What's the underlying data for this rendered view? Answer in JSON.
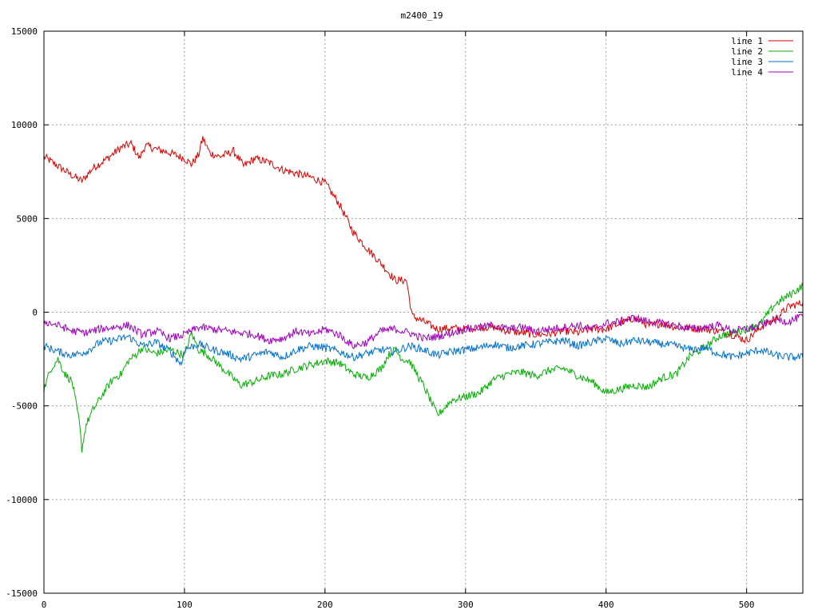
{
  "chart_data": {
    "type": "line",
    "title": "m2400_19",
    "xlabel": "",
    "ylabel": "",
    "xlim": [
      0,
      540
    ],
    "ylim": [
      -15000,
      15000
    ],
    "xticks": [
      0,
      100,
      200,
      300,
      400,
      500
    ],
    "yticks": [
      -15000,
      -10000,
      -5000,
      0,
      5000,
      10000,
      15000
    ],
    "grid": true,
    "legend_position": "top-right",
    "series": [
      {
        "name": "line 1",
        "color": "#dd0000",
        "x": [
          0,
          10,
          20,
          27,
          35,
          45,
          55,
          62,
          68,
          72,
          80,
          90,
          100,
          105,
          110,
          113,
          118,
          125,
          135,
          142,
          150,
          160,
          170,
          180,
          190,
          200,
          210,
          220,
          230,
          240,
          250,
          258,
          262,
          270,
          280,
          290,
          300,
          310,
          320,
          330,
          340,
          350,
          360,
          370,
          380,
          390,
          400,
          410,
          420,
          430,
          440,
          450,
          460,
          470,
          480,
          490,
          500,
          510,
          520,
          530,
          540
        ],
        "y": [
          8300,
          7800,
          7300,
          7000,
          7700,
          8200,
          8800,
          9000,
          8200,
          8900,
          8700,
          8500,
          8200,
          7900,
          8400,
          9300,
          8500,
          8300,
          8600,
          7800,
          8200,
          8000,
          7600,
          7400,
          7200,
          6900,
          5800,
          4300,
          3400,
          2600,
          1700,
          1700,
          -200,
          -500,
          -900,
          -850,
          -900,
          -800,
          -800,
          -1000,
          -1100,
          -1200,
          -1150,
          -1000,
          -1100,
          -900,
          -900,
          -600,
          -300,
          -700,
          -600,
          -800,
          -850,
          -900,
          -1000,
          -1200,
          -1500,
          -800,
          -400,
          300,
          500
        ]
      },
      {
        "name": "line 2",
        "color": "#00b000",
        "x": [
          0,
          5,
          10,
          15,
          20,
          25,
          27,
          30,
          35,
          40,
          45,
          50,
          55,
          60,
          65,
          70,
          75,
          80,
          90,
          100,
          105,
          110,
          115,
          120,
          130,
          140,
          150,
          160,
          170,
          180,
          190,
          200,
          210,
          220,
          230,
          240,
          245,
          250,
          255,
          260,
          270,
          280,
          290,
          300,
          310,
          320,
          330,
          340,
          350,
          360,
          370,
          380,
          390,
          400,
          410,
          420,
          430,
          440,
          450,
          460,
          470,
          480,
          490,
          500,
          510,
          520,
          530,
          540
        ],
        "y": [
          -4100,
          -3000,
          -2500,
          -3300,
          -3700,
          -5800,
          -7300,
          -6000,
          -5200,
          -4600,
          -4000,
          -3500,
          -3300,
          -2600,
          -2300,
          -1900,
          -2100,
          -2200,
          -2000,
          -2300,
          -1100,
          -2000,
          -2200,
          -2500,
          -3200,
          -3900,
          -3700,
          -3400,
          -3300,
          -3000,
          -2800,
          -2600,
          -2700,
          -3300,
          -3500,
          -3000,
          -2300,
          -2000,
          -2500,
          -2600,
          -3900,
          -5500,
          -4700,
          -4500,
          -4300,
          -3600,
          -3300,
          -3200,
          -3400,
          -3100,
          -3000,
          -3400,
          -3700,
          -4300,
          -4100,
          -3900,
          -4000,
          -3500,
          -3300,
          -2300,
          -1900,
          -1300,
          -1100,
          -900,
          -600,
          400,
          900,
          1400
        ]
      },
      {
        "name": "line 3",
        "color": "#0070d0",
        "x": [
          0,
          10,
          20,
          30,
          40,
          50,
          60,
          70,
          80,
          90,
          98,
          100,
          110,
          120,
          130,
          140,
          150,
          160,
          170,
          180,
          190,
          200,
          210,
          220,
          230,
          240,
          250,
          260,
          270,
          280,
          290,
          300,
          310,
          320,
          330,
          340,
          350,
          360,
          370,
          380,
          390,
          400,
          410,
          420,
          430,
          440,
          450,
          460,
          470,
          480,
          490,
          500,
          510,
          520,
          530,
          540
        ],
        "y": [
          -1800,
          -2100,
          -2300,
          -2100,
          -1600,
          -1500,
          -1300,
          -1800,
          -1600,
          -2100,
          -2800,
          -2000,
          -1700,
          -2000,
          -2200,
          -2500,
          -2300,
          -2100,
          -2400,
          -2000,
          -1800,
          -1900,
          -2100,
          -2400,
          -2200,
          -2000,
          -2100,
          -1800,
          -2000,
          -2300,
          -2100,
          -2000,
          -1900,
          -1700,
          -1900,
          -1800,
          -1700,
          -1600,
          -1500,
          -1800,
          -1600,
          -1400,
          -1700,
          -1500,
          -1600,
          -1700,
          -1800,
          -2000,
          -1900,
          -2200,
          -2400,
          -2200,
          -2000,
          -2300,
          -2400,
          -2400
        ]
      },
      {
        "name": "line 4",
        "color": "#a000c0",
        "x": [
          0,
          10,
          20,
          30,
          40,
          50,
          60,
          70,
          80,
          90,
          100,
          110,
          120,
          130,
          140,
          150,
          160,
          170,
          180,
          190,
          200,
          210,
          220,
          230,
          240,
          250,
          260,
          270,
          280,
          290,
          300,
          310,
          320,
          330,
          340,
          350,
          360,
          370,
          380,
          390,
          400,
          410,
          420,
          430,
          440,
          450,
          460,
          470,
          480,
          490,
          500,
          510,
          520,
          530,
          540
        ],
        "y": [
          -500,
          -700,
          -1000,
          -1100,
          -900,
          -800,
          -700,
          -1200,
          -1000,
          -1400,
          -1200,
          -800,
          -900,
          -1000,
          -1100,
          -1200,
          -1500,
          -1400,
          -1000,
          -1200,
          -900,
          -1200,
          -1800,
          -1600,
          -1000,
          -900,
          -1100,
          -1400,
          -1300,
          -1100,
          -900,
          -800,
          -700,
          -900,
          -800,
          -1000,
          -900,
          -800,
          -700,
          -900,
          -600,
          -500,
          -300,
          -500,
          -600,
          -700,
          -900,
          -800,
          -700,
          -1000,
          -900,
          -700,
          -400,
          -500,
          -200
        ]
      }
    ]
  }
}
